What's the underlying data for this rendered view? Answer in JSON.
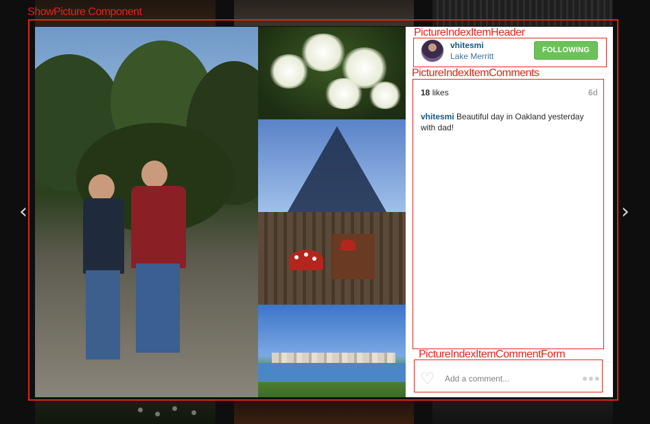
{
  "annotations": {
    "show_picture": "ShowPicture Component",
    "header": "PictureIndexItemHeader",
    "comments": "PictureIndexItemComments",
    "comment_form": "PictureIndexItemCommentForm"
  },
  "navigation": {
    "prev_icon": "chevron-left-icon",
    "next_icon": "chevron-right-icon",
    "prev_glyph": "‹",
    "next_glyph": "›"
  },
  "header": {
    "avatar_icon": "user-avatar",
    "username": "vhitesmi",
    "location": "Lake Merritt",
    "follow_label": "FOLLOWING",
    "follow_color": "#6bc259"
  },
  "comments": {
    "likes_count": "18",
    "likes_label": "likes",
    "age": "6d",
    "caption_user": "vhitesmi",
    "caption_text": "Beautiful day in Oakland yesterday with dad!"
  },
  "comment_form": {
    "heart_icon": "heart-icon",
    "heart_glyph": "♡",
    "placeholder": "Add a comment...",
    "more_icon": "more-options-icon"
  },
  "colors": {
    "annotation": "#e2231a",
    "link": "#125688",
    "location": "#3f729b"
  }
}
